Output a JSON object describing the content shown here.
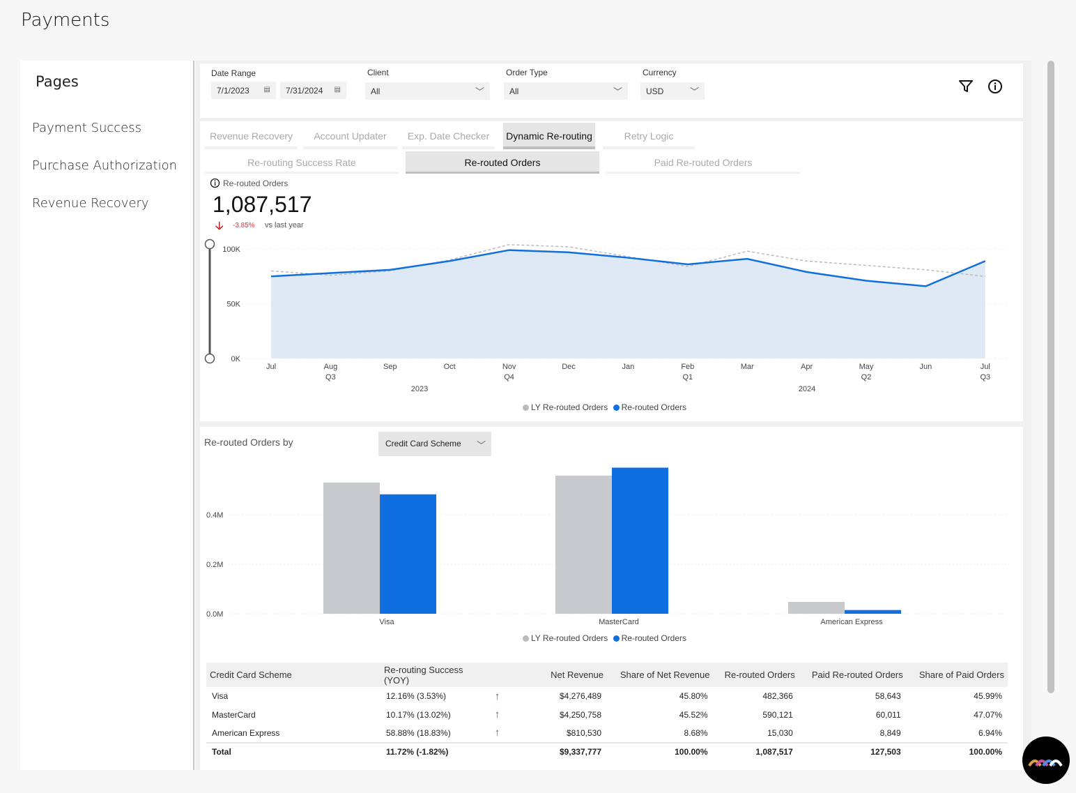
{
  "page_title": "Payments",
  "sidebar": {
    "heading": "Pages",
    "items": [
      {
        "label": "Payment Success"
      },
      {
        "label": "Purchase Authorization"
      },
      {
        "label": "Revenue Recovery"
      }
    ]
  },
  "filters": {
    "date_range_label": "Date Range",
    "date_start": "7/1/2023",
    "date_end": "7/31/2024",
    "client_label": "Client",
    "client_value": "All",
    "order_type_label": "Order Type",
    "order_type_value": "All",
    "currency_label": "Currency",
    "currency_value": "USD",
    "icons": [
      "filter-icon",
      "info-icon",
      "calendar-icon",
      "chevron-down-icon"
    ]
  },
  "tabs": [
    {
      "label": "Revenue Recovery"
    },
    {
      "label": "Account Updater"
    },
    {
      "label": "Exp. Date Checker"
    },
    {
      "label": "Dynamic Re-routing",
      "active": true
    },
    {
      "label": "Retry Logic"
    }
  ],
  "subtabs": [
    {
      "label": "Re-routing Success Rate"
    },
    {
      "label": "Re-routed Orders",
      "active": true
    },
    {
      "label": "Paid Re-routed Orders"
    }
  ],
  "kpi": {
    "label": "Re-routed Orders",
    "value": "1,087,517",
    "change": "-3.85%",
    "change_color": "#d13438",
    "compare": "vs last year"
  },
  "colors": {
    "current": "#0f6fde",
    "last_year": "#c8cacd",
    "area": "#dfe9f5"
  },
  "chart_data": [
    {
      "type": "area",
      "x": [
        "Jul",
        "Aug",
        "Sep",
        "Oct",
        "Nov",
        "Dec",
        "Jan",
        "Feb",
        "Mar",
        "Apr",
        "May",
        "Jun",
        "Jul"
      ],
      "x_sublabels": [
        "",
        "Q3",
        "",
        "",
        "Q4",
        "",
        "",
        "Q1",
        "",
        "",
        "Q2",
        "",
        "Q3"
      ],
      "year_labels": [
        "2023",
        "2024"
      ],
      "yticks": [
        "0K",
        "50K",
        "100K"
      ],
      "ylim": [
        0,
        100000
      ],
      "series": [
        {
          "name": "LY Re-routed Orders",
          "values": [
            80000,
            76000,
            80000,
            90000,
            104000,
            102000,
            93000,
            84000,
            98000,
            89000,
            85000,
            81000,
            75000
          ]
        },
        {
          "name": "Re-routed Orders",
          "values": [
            75000,
            78000,
            81000,
            89000,
            99000,
            97000,
            92000,
            86000,
            91000,
            79000,
            71000,
            66000,
            89000
          ]
        }
      ],
      "legend": "bottom"
    },
    {
      "type": "bar",
      "title": "Re-routed Orders by",
      "dropdown": "Credit Card Scheme",
      "categories": [
        "Visa",
        "MasterCard",
        "American Express"
      ],
      "yticks": [
        "0.0M",
        "0.2M",
        "0.4M"
      ],
      "ylim": [
        0,
        0.6
      ],
      "series": [
        {
          "name": "LY Re-routed Orders",
          "values": [
            0.53,
            0.558,
            0.048
          ]
        },
        {
          "name": "Re-routed Orders",
          "values": [
            0.482366,
            0.590121,
            0.01503
          ]
        }
      ],
      "legend": "bottom"
    }
  ],
  "table": {
    "headers": [
      "Credit Card Scheme",
      "Re-routing Success (YOY)",
      "",
      "Net Revenue",
      "Share of Net Revenue",
      "Re-routed Orders",
      "Paid Re-routed Orders",
      "Share of Paid Orders"
    ],
    "rows": [
      [
        "Visa",
        "12.16% (3.53%)",
        "↑",
        "$4,276,489",
        "45.80%",
        "482,366",
        "58,643",
        "45.99%"
      ],
      [
        "MasterCard",
        "10.17% (13.02%)",
        "↑",
        "$4,250,758",
        "45.52%",
        "590,121",
        "60,011",
        "47.07%"
      ],
      [
        "American Express",
        "58.88% (18.83%)",
        "↑",
        "$810,530",
        "8.68%",
        "15,030",
        "8,849",
        "6.94%"
      ]
    ],
    "total": [
      "Total",
      "11.72% (-1.82%)",
      "",
      "$9,337,777",
      "100.00%",
      "1,087,517",
      "127,503",
      "100.00%"
    ]
  }
}
